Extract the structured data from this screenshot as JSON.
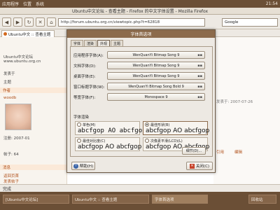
{
  "topbar": {
    "apps": "应用程序",
    "places": "位置",
    "system": "系统",
    "clock": "21:54"
  },
  "browser": {
    "title": "Ubuntu中文论坛 - 查看主题 - Firefox 的中文字体设置 - Mozilla Firefox",
    "url": "http://forum.ubuntu.org.cn/viewtopic.php?t=62818",
    "search_placeholder": "Google",
    "tab_label": "Ubuntu中文 :: 查看主题"
  },
  "page": {
    "left_lines": [
      "Ubuntu中文论坛",
      "www.ubuntu.org.cn",
      "发表于",
      "主题"
    ],
    "section1": "作者",
    "section2": "消息",
    "user_name": "woodb",
    "user_info": [
      "注册: 2007-01",
      "帖子: 64"
    ],
    "footer_links": [
      "返回页首",
      "发表帖子"
    ],
    "right_lines": [
      "发表于: 2007-07-26",
      "引用",
      "编辑"
    ]
  },
  "dialog": {
    "title": "字体首选项",
    "tabs": [
      "字体",
      "渲染",
      "外观",
      "主题"
    ],
    "active_tab": 2,
    "fonts": [
      {
        "label": "应用程序字体(A):",
        "value": "WenQuanYi Bitmap Song 9"
      },
      {
        "label": "文档字体(D):",
        "value": "WenQuanYi Bitmap Song 9"
      },
      {
        "label": "桌面字体(E):",
        "value": "WenQuanYi Bitmap Song 9"
      },
      {
        "label": "窗口标题字体(W):",
        "value": "WenQuanYi Bitmap Song Bold 9"
      },
      {
        "label": "等宽字体(F):",
        "value": "Monospace 9"
      }
    ],
    "render_label": "字体渲染",
    "render_options": [
      {
        "name": "单色(M)",
        "sample": "abcfgop AO abcfgop",
        "selected": false
      },
      {
        "name": "最佳形状(B)",
        "sample": "abcfgop AO abcfgop",
        "selected": true
      },
      {
        "name": "最佳对比度(C)",
        "sample": "abcfgop AO abcfgop",
        "selected": false
      },
      {
        "name": "次像素平滑(LCD)(L)",
        "sample": "abcfgop AO abcfgop",
        "selected": false
      }
    ],
    "details_label": "细节(D)...",
    "help_label": "帮助(H)",
    "close_label": "关闭(C)"
  },
  "statusbar": {
    "text": "完成"
  },
  "taskbar": {
    "items": [
      "[Ubuntu中文论坛]",
      "Ubuntu中文 :: 查看主题",
      "字体首选项"
    ],
    "trash": "回收站"
  }
}
